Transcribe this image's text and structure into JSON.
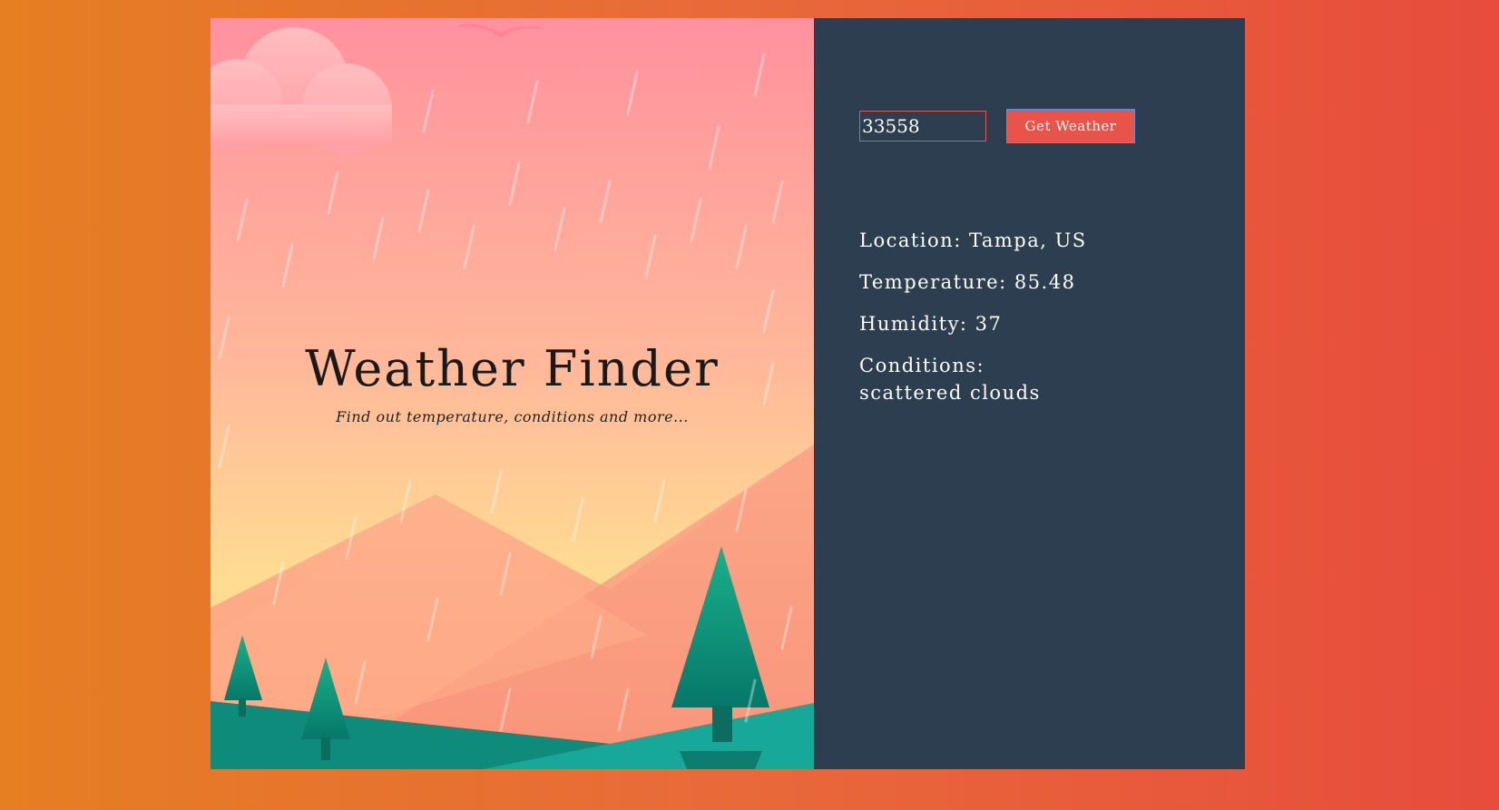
{
  "hero": {
    "title": "Weather Finder",
    "subtitle": "Find out temperature, conditions and more..."
  },
  "form": {
    "zip_value": "33558",
    "button_label": "Get Weather"
  },
  "results": {
    "location": "Location: Tampa, US",
    "temperature": "Temperature: 85.48",
    "humidity": "Humidity: 37",
    "conditions_label": "Conditions:",
    "conditions_value": "scattered clouds"
  },
  "colors": {
    "background_left": "#e67e22",
    "background_right": "#e74c3c",
    "panel": "#2d3e50",
    "button": "#e8544a",
    "sky_top": "#ff8f9c",
    "sky_bottom": "#ffd98e",
    "tree": "#0e8c78",
    "ground": "#17a89a"
  }
}
